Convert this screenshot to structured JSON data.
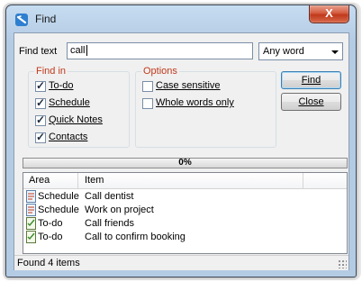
{
  "window": {
    "title": "Find",
    "close_glyph": "X"
  },
  "search": {
    "label": "Find text",
    "value": "call",
    "mode_selected": "Any word"
  },
  "find_in": {
    "title": "Find in",
    "items": [
      {
        "label": "To-do",
        "checked": true
      },
      {
        "label": "Schedule",
        "checked": true
      },
      {
        "label": "Quick Notes",
        "checked": true
      },
      {
        "label": "Contacts",
        "checked": true
      }
    ]
  },
  "options": {
    "title": "Options",
    "items": [
      {
        "label": "Case sensitive",
        "checked": false
      },
      {
        "label": "Whole words only",
        "checked": false
      }
    ]
  },
  "buttons": {
    "find": "Find",
    "close": "Close"
  },
  "progress": {
    "text": "0%",
    "value": 0
  },
  "results": {
    "columns": [
      "Area",
      "Item"
    ],
    "rows": [
      {
        "area": "Schedule",
        "item": "Call dentist",
        "icon": "schedule-icon"
      },
      {
        "area": "Schedule",
        "item": "Work on project",
        "icon": "schedule-icon"
      },
      {
        "area": "To-do",
        "item": "Call friends",
        "icon": "todo-icon"
      },
      {
        "area": "To-do",
        "item": "Call to confirm booking",
        "icon": "todo-icon"
      }
    ]
  },
  "status": {
    "text": "Found 4 items"
  },
  "colors": {
    "group_title": "#c0391a",
    "close_button": "#c0391a"
  }
}
